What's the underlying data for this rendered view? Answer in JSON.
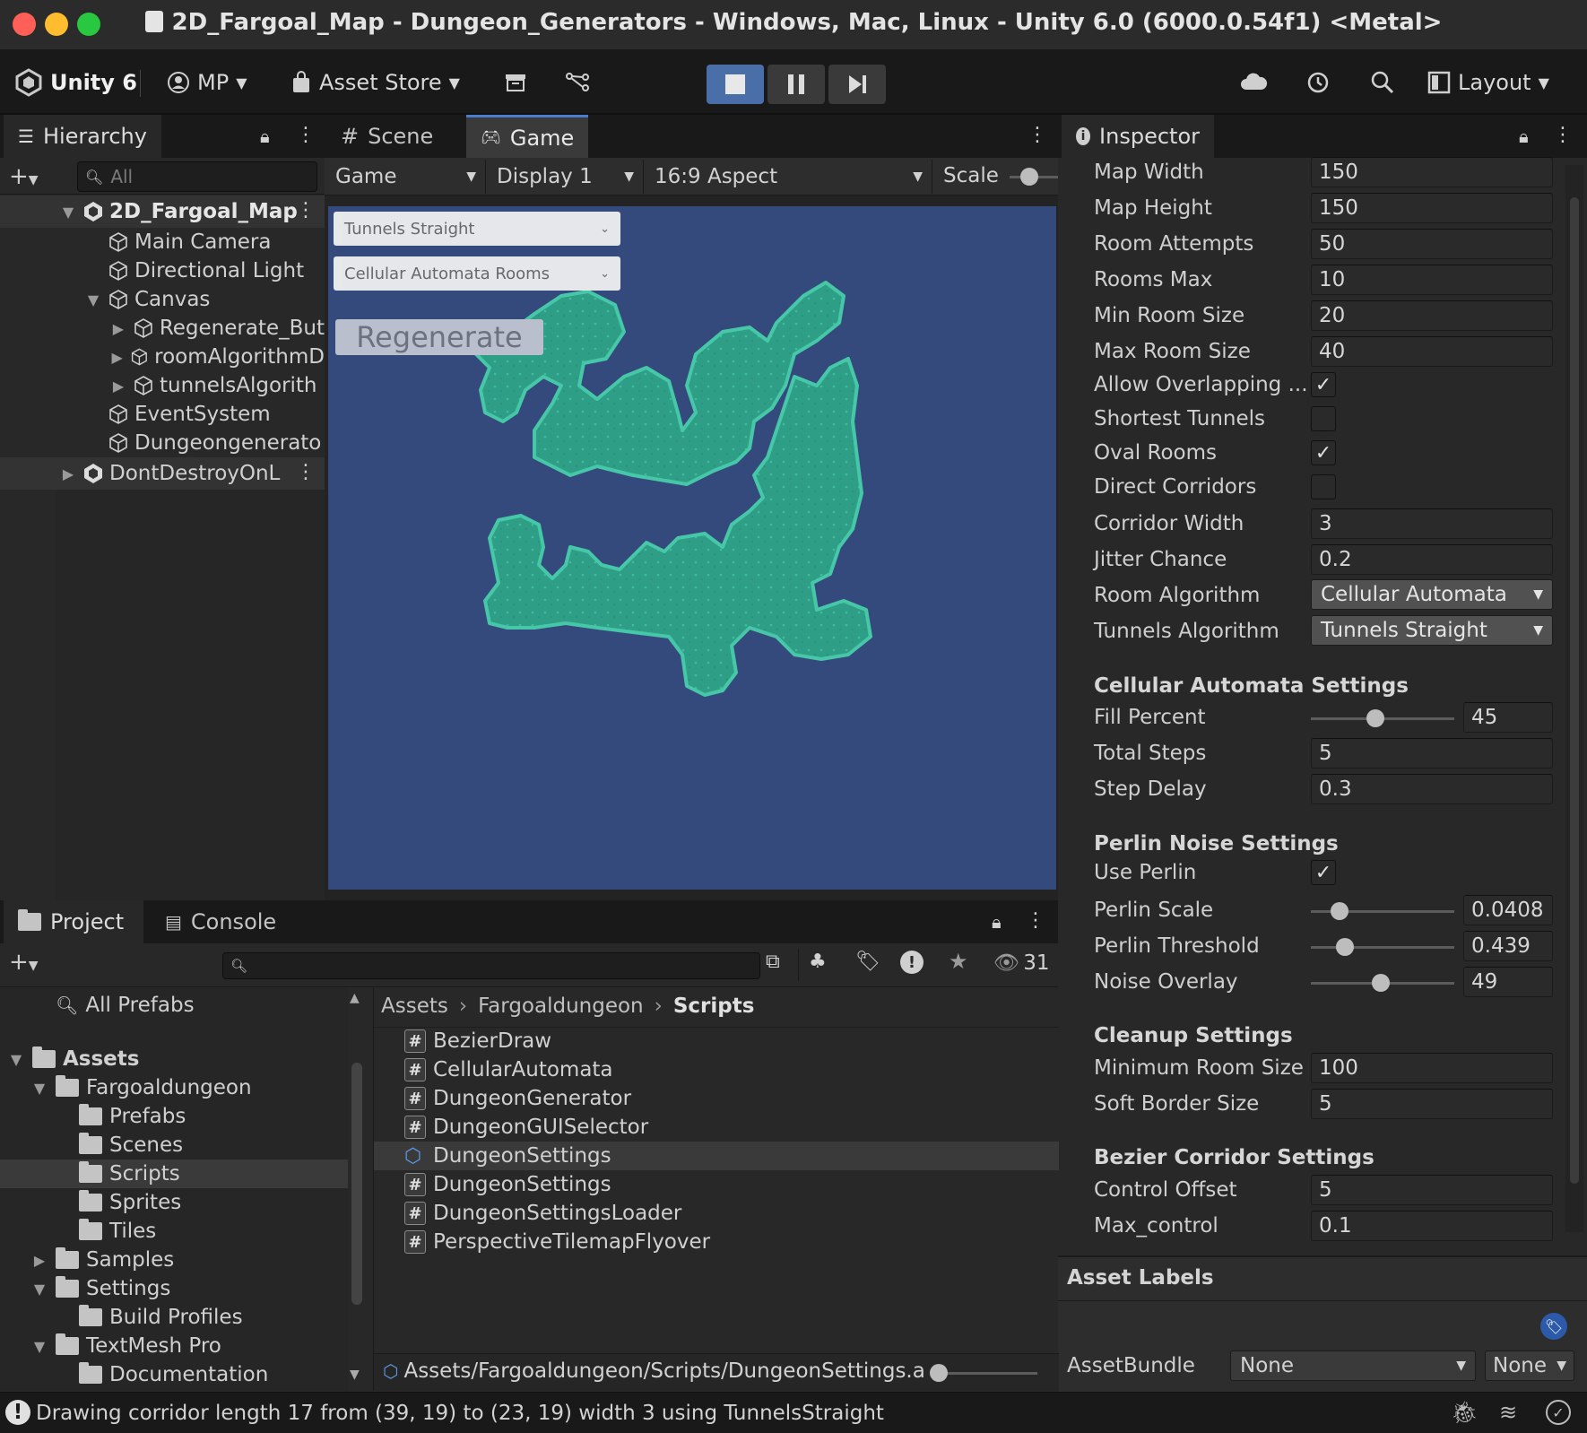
{
  "window": {
    "title": "2D_Fargoal_Map - Dungeon_Generators - Windows, Mac, Linux - Unity 6.0 (6000.0.54f1) <Metal>"
  },
  "toolbar": {
    "brand": "Unity 6",
    "account": "MP",
    "asset_store": "Asset Store",
    "layout": "Layout"
  },
  "hierarchy": {
    "tab": "Hierarchy",
    "search_placeholder": "All",
    "root": "2D_Fargoal_Map",
    "items": [
      "Main Camera",
      "Directional Light",
      "Canvas",
      "Regenerate_But",
      "roomAlgorithmD",
      "tunnelsAlgorith",
      "EventSystem",
      "Dungeongenerato"
    ],
    "dont_destroy": "DontDestroyOnL"
  },
  "game_view": {
    "tabs": [
      "Scene",
      "Game"
    ],
    "mode": "Game",
    "display": "Display 1",
    "aspect": "16:9 Aspect",
    "scale_label": "Scale",
    "ui_dropdown_1": "Tunnels Straight",
    "ui_dropdown_2": "Cellular Automata Rooms",
    "ui_button": "Regenerate"
  },
  "inspector": {
    "tab": "Inspector",
    "fields": [
      {
        "label": "Map Width",
        "value": "150"
      },
      {
        "label": "Map Height",
        "value": "150"
      },
      {
        "label": "Room Attempts",
        "value": "50"
      },
      {
        "label": "Rooms Max",
        "value": "10"
      },
      {
        "label": "Min Room Size",
        "value": "20"
      },
      {
        "label": "Max Room Size",
        "value": "40"
      }
    ],
    "checkboxes": [
      {
        "label": "Allow Overlapping ...",
        "checked": "✓"
      },
      {
        "label": "Shortest Tunnels",
        "checked": ""
      },
      {
        "label": "Oval Rooms",
        "checked": "✓"
      },
      {
        "label": "Direct Corridors",
        "checked": ""
      }
    ],
    "corridor_width": {
      "label": "Corridor Width",
      "value": "3"
    },
    "jitter_chance": {
      "label": "Jitter Chance",
      "value": "0.2"
    },
    "room_algorithm": {
      "label": "Room Algorithm",
      "value": "Cellular Automata"
    },
    "tunnels_algorithm": {
      "label": "Tunnels Algorithm",
      "value": "Tunnels Straight"
    },
    "cellular": {
      "header": "Cellular Automata Settings",
      "fill_percent": {
        "label": "Fill Percent",
        "value": "45",
        "fraction": 0.45
      },
      "total_steps": {
        "label": "Total Steps",
        "value": "5"
      },
      "step_delay": {
        "label": "Step Delay",
        "value": "0.3"
      }
    },
    "perlin": {
      "header": "Perlin Noise Settings",
      "use_perlin": {
        "label": "Use Perlin",
        "checked": "✓"
      },
      "scale": {
        "label": "Perlin Scale",
        "value": "0.0408",
        "fraction": 0.2
      },
      "threshold": {
        "label": "Perlin Threshold",
        "value": "0.439",
        "fraction": 0.24
      },
      "noise_overlay": {
        "label": "Noise Overlay",
        "value": "49",
        "fraction": 0.49
      }
    },
    "cleanup": {
      "header": "Cleanup Settings",
      "min_room": {
        "label": "Minimum Room Size",
        "value": "100"
      },
      "soft_border": {
        "label": "Soft Border Size",
        "value": "5"
      }
    },
    "bezier": {
      "header": "Bezier Corridor Settings",
      "control_offset": {
        "label": "Control Offset",
        "value": "5"
      },
      "max_control": {
        "label": "Max_control",
        "value": "0.1"
      }
    },
    "asset_labels": "Asset Labels",
    "asset_bundle": {
      "label": "AssetBundle",
      "value": "None",
      "variant": "None"
    }
  },
  "project": {
    "tabs": [
      "Project",
      "Console"
    ],
    "hidden_count": "31",
    "all_prefabs": "All Prefabs",
    "tree": [
      {
        "label": "Assets",
        "depth": 0,
        "arrow": "▼",
        "bold": true
      },
      {
        "label": "Fargoaldungeon",
        "depth": 1,
        "arrow": "▼"
      },
      {
        "label": "Prefabs",
        "depth": 2,
        "arrow": ""
      },
      {
        "label": "Scenes",
        "depth": 2,
        "arrow": ""
      },
      {
        "label": "Scripts",
        "depth": 2,
        "arrow": "",
        "selected": true
      },
      {
        "label": "Sprites",
        "depth": 2,
        "arrow": ""
      },
      {
        "label": "Tiles",
        "depth": 2,
        "arrow": ""
      },
      {
        "label": "Samples",
        "depth": 1,
        "arrow": "▶"
      },
      {
        "label": "Settings",
        "depth": 1,
        "arrow": "▼"
      },
      {
        "label": "Build Profiles",
        "depth": 2,
        "arrow": ""
      },
      {
        "label": "TextMesh Pro",
        "depth": 1,
        "arrow": "▼"
      },
      {
        "label": "Documentation",
        "depth": 2,
        "arrow": ""
      }
    ],
    "breadcrumb": [
      "Assets",
      "Fargoaldungeon",
      "Scripts"
    ],
    "files": [
      {
        "name": "BezierDraw",
        "kind": "script"
      },
      {
        "name": "CellularAutomata",
        "kind": "script"
      },
      {
        "name": "DungeonGenerator",
        "kind": "script"
      },
      {
        "name": "DungeonGUISelector",
        "kind": "script"
      },
      {
        "name": "DungeonSettings",
        "kind": "asset",
        "selected": true
      },
      {
        "name": "DungeonSettings",
        "kind": "script"
      },
      {
        "name": "DungeonSettingsLoader",
        "kind": "script"
      },
      {
        "name": "PerspectiveTilemapFlyover",
        "kind": "script"
      }
    ],
    "path": "Assets/Fargoaldungeon/Scripts/DungeonSettings.a"
  },
  "status": {
    "message": "Drawing corridor length 17 from (39, 19) to (23, 19) width 3 using TunnelsStraight"
  },
  "colors": {
    "accent": "#4c7ccd",
    "game_bg": "#344a7c",
    "dungeon_fill": "#2f9e86",
    "dungeon_edge": "#46c8a8"
  }
}
